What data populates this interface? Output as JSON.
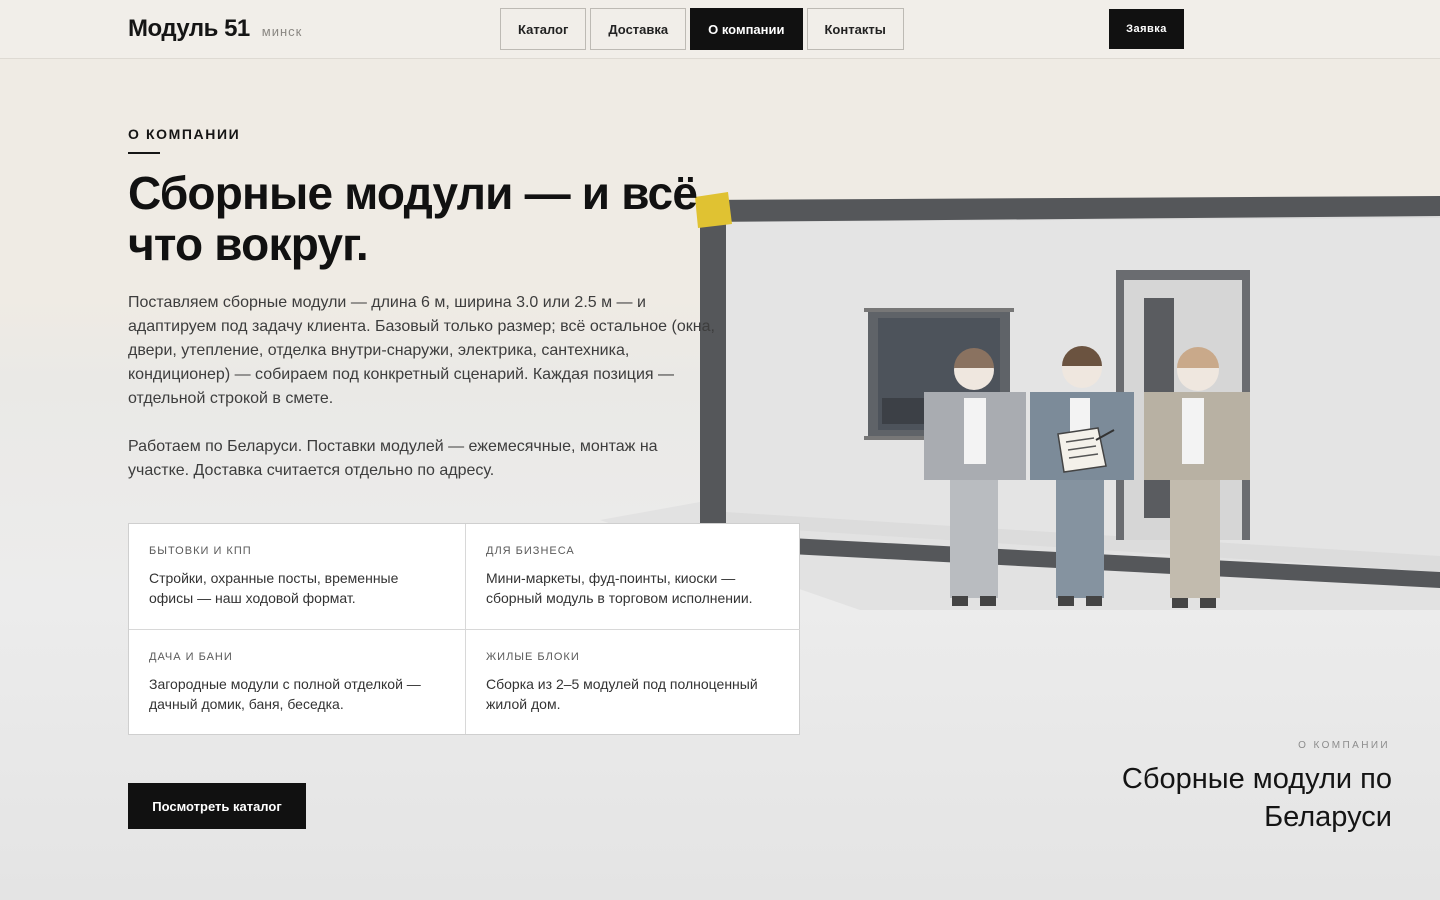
{
  "header": {
    "logo": "Модуль 51",
    "city": "минск",
    "nav": [
      {
        "label": "Каталог",
        "active": false
      },
      {
        "label": "Доставка",
        "active": false
      },
      {
        "label": "О компании",
        "active": true
      },
      {
        "label": "Контакты",
        "active": false
      }
    ],
    "cta": "Заявка"
  },
  "main": {
    "eyebrow": "О КОМПАНИИ",
    "title": "Сборные модули — и всё что вокруг.",
    "paragraphs": [
      "Поставляем сборные модули — длина 6 м, ширина 3.0 или 2.5 м — и адаптируем под задачу клиента. Базовый только размер; всё остальное (окна, двери, утепление, отделка внутри-снаружи, электрика, сантехника, кондиционер) — собираем под конкретный сценарий. Каждая позиция — отдельной строкой в смете.",
      "Работаем по Беларуси. Поставки модулей — ежемесячные, монтаж на участке. Доставка считается отдельно по адресу."
    ],
    "cards": [
      {
        "label": "БЫТОВКИ И КПП",
        "text": "Стройки, охранные посты, временные офисы — наш ходовой формат."
      },
      {
        "label": "ДЛЯ БИЗНЕСА",
        "text": "Мини-маркеты, фуд-поинты, киоски — сборный модуль в торговом исполнении."
      },
      {
        "label": "ДАЧА И БАНИ",
        "text": "Загородные модули с полной отделкой — дачный домик, баня, беседка."
      },
      {
        "label": "ЖИЛЫЕ БЛОКИ",
        "text": "Сборка из 2–5 модулей под полноценный жилой дом."
      }
    ],
    "button": "Посмотреть каталог"
  },
  "side": {
    "eyebrow": "О КОМПАНИИ",
    "title": "Сборные модули по Беларуси"
  },
  "colors": {
    "accent": "#111111",
    "background": "#efebe4",
    "module_frame": "#55575a",
    "worker_grey": "#a9acb1",
    "worker_blue": "#7c8b99",
    "worker_beige": "#b8b1a3"
  }
}
